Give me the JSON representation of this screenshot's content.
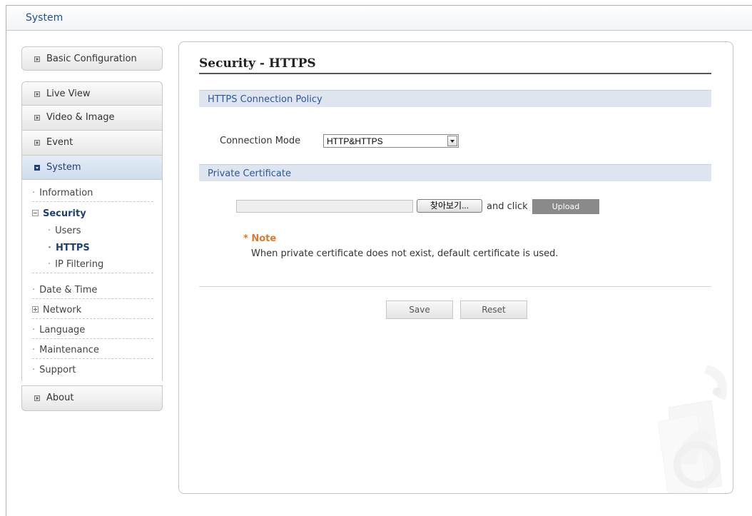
{
  "window": {
    "title": "System"
  },
  "sidebar": {
    "basic_configuration": "Basic Configuration",
    "live_view": "Live View",
    "video_image": "Video & Image",
    "event": "Event",
    "system": "System",
    "about": "About",
    "system_items": {
      "information": "Information",
      "security": "Security",
      "users": "Users",
      "https": "HTTPS",
      "ip_filtering": "IP Filtering",
      "date_time": "Date & Time",
      "network": "Network",
      "language": "Language",
      "maintenance": "Maintenance",
      "support": "Support"
    }
  },
  "main": {
    "title": "Security - HTTPS",
    "connection_policy": {
      "heading": "HTTPS Connection Policy",
      "mode_label": "Connection Mode",
      "mode_value": "HTTP&HTTPS"
    },
    "private_certificate": {
      "heading": "Private Certificate",
      "file_value": "",
      "browse_label": "찾아보기...",
      "and_click": "and click",
      "upload_label": "Upload",
      "note_title": "* Note",
      "note_text": "When private certificate does not exist, default certificate is used."
    },
    "save_label": "Save",
    "reset_label": "Reset"
  },
  "colors": {
    "accent": "#2b56a2",
    "note": "#e0772a",
    "section_bg": "#dfe5ee"
  }
}
